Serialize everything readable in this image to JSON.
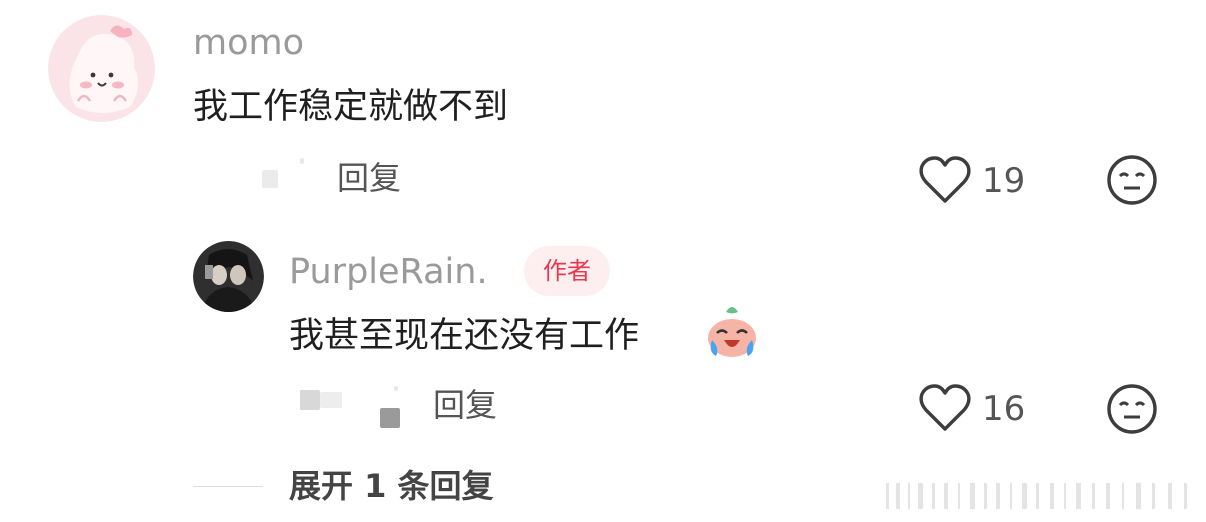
{
  "comment": {
    "username": "momo",
    "text": "我工作稳定就做不到",
    "reply_label": "回复",
    "like_count": "19"
  },
  "reply": {
    "username": "PurpleRain.",
    "author_badge": "作者",
    "text": "我甚至现在还没有工作",
    "reply_label": "回复",
    "like_count": "16"
  },
  "expand_label": "展开 1 条回复",
  "icons": {
    "like": "heart-outline-icon",
    "dislike": "neutral-face-icon",
    "emoji": "crying-laughing-sticker-icon"
  },
  "colors": {
    "username": "#9a9a9a",
    "badge_text": "#e83a4f",
    "badge_bg": "#fdeef0"
  }
}
